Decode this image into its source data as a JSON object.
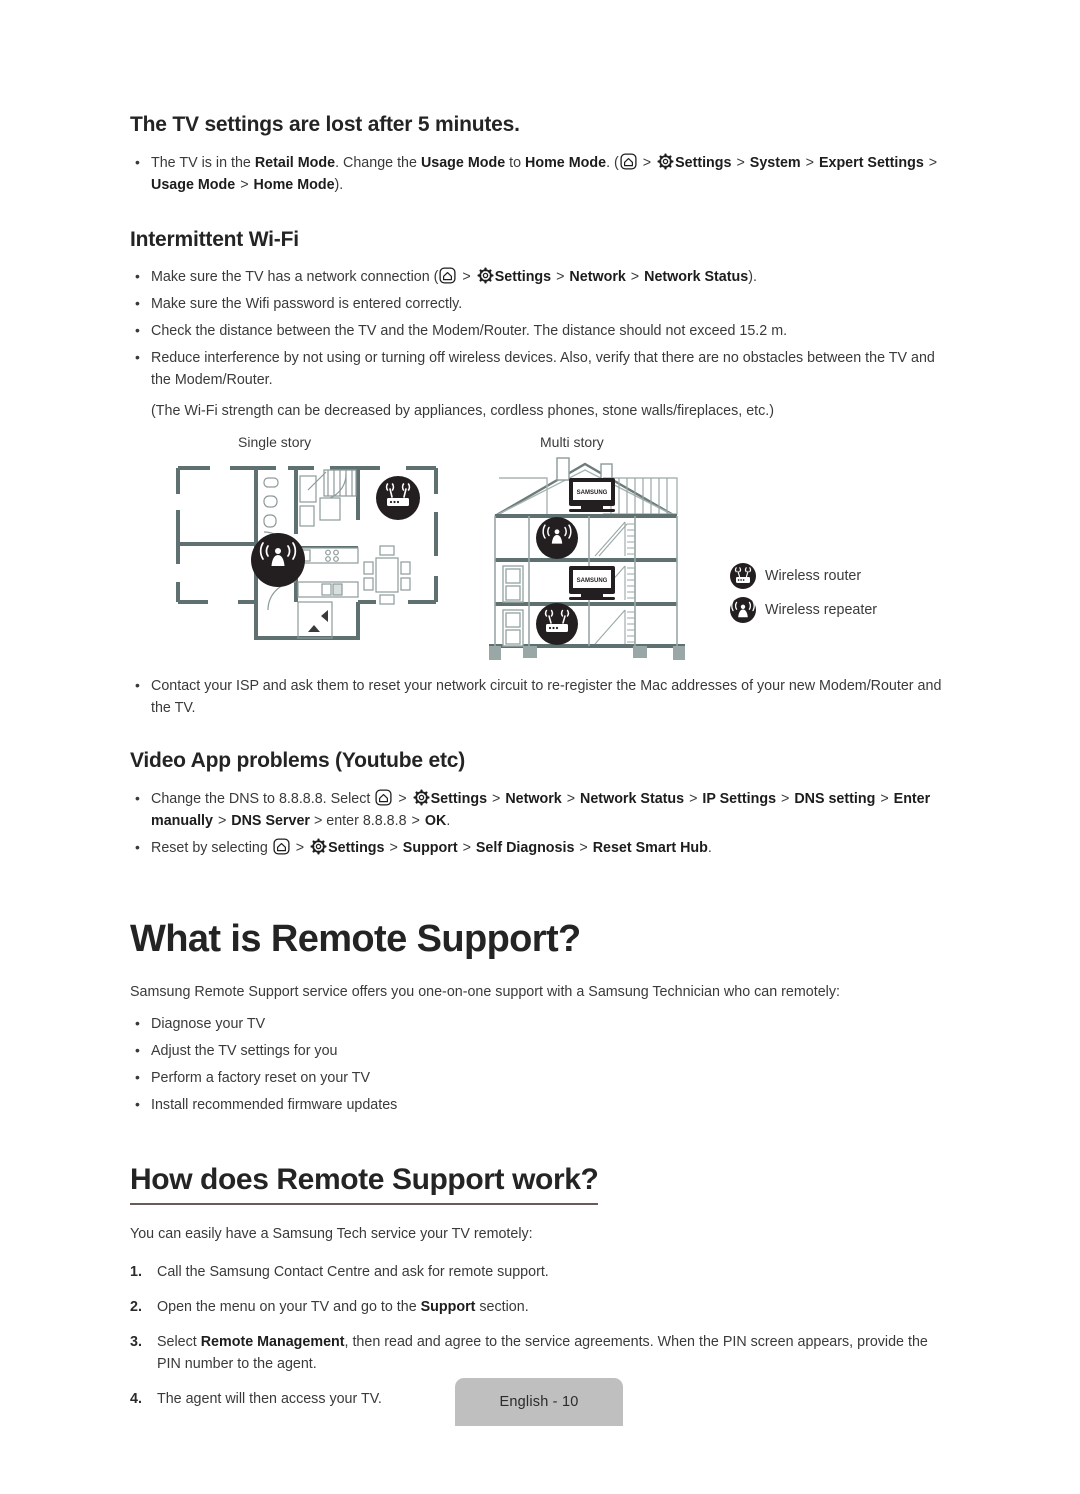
{
  "document": {
    "footer_label": "English - 10",
    "icons": {
      "home": "home-icon",
      "gear": "gear-icon"
    }
  },
  "colors": {
    "text": "#3a3a3a",
    "heading": "#242424",
    "wall": "#5f7070",
    "badge": "#231f20",
    "footer_bg": "#bfbfbf",
    "rule": "#6b5a5a"
  },
  "sections": {
    "tv_settings_lost": {
      "heading": "The TV settings are lost after 5 minutes.",
      "bullets": [
        {
          "parts": [
            {
              "t": "The TV is in the "
            },
            {
              "t": "Retail Mode",
              "b": true
            },
            {
              "t": ". Change the "
            },
            {
              "t": "Usage Mode",
              "b": true
            },
            {
              "t": " to "
            },
            {
              "t": "Home Mode",
              "b": true
            },
            {
              "t": ". ("
            },
            {
              "icon": "home-icon"
            },
            {
              "t": " > ",
              "sep": true
            },
            {
              "icon": "gear-icon"
            },
            {
              "t": "Settings",
              "b": true
            },
            {
              "t": " > ",
              "sep": true
            },
            {
              "t": "System",
              "b": true
            },
            {
              "t": " > ",
              "sep": true
            },
            {
              "t": "Expert Settings",
              "b": true
            },
            {
              "t": " > ",
              "sep": true
            },
            {
              "t": "Usage Mode",
              "b": true
            },
            {
              "t": " > ",
              "sep": true
            },
            {
              "t": "Home Mode",
              "b": true
            },
            {
              "t": ")."
            }
          ]
        }
      ]
    },
    "intermittent_wifi": {
      "heading": "Intermittent Wi-Fi",
      "bullets": [
        {
          "parts": [
            {
              "t": "Make sure the TV has a network connection ("
            },
            {
              "icon": "home-icon"
            },
            {
              "t": " > ",
              "sep": true
            },
            {
              "icon": "gear-icon"
            },
            {
              "t": "Settings",
              "b": true
            },
            {
              "t": " > ",
              "sep": true
            },
            {
              "t": "Network",
              "b": true
            },
            {
              "t": " > ",
              "sep": true
            },
            {
              "t": "Network Status",
              "b": true
            },
            {
              "t": ")."
            }
          ]
        },
        {
          "parts": [
            {
              "t": "Make sure the Wifi password is entered correctly."
            }
          ]
        },
        {
          "parts": [
            {
              "t": "Check the distance between the TV and the Modem/Router. The distance should not exceed 15.2 m."
            }
          ]
        },
        {
          "parts": [
            {
              "t": "Reduce interference by not using or turning off wireless devices. Also, verify that there are no obstacles between the TV and the Modem/Router."
            }
          ]
        }
      ],
      "note": "(The Wi-Fi strength can be decreased by appliances, cordless phones, stone walls/fireplaces, etc.)",
      "diagram": {
        "caption_single": "Single story",
        "caption_multi": "Multi story",
        "tv_brand": "SAMSUNG",
        "legend": [
          {
            "icon": "wireless-router-icon",
            "label": "Wireless router"
          },
          {
            "icon": "wireless-repeater-icon",
            "label": "Wireless repeater"
          }
        ]
      },
      "trailing_bullets": [
        {
          "parts": [
            {
              "t": "Contact your ISP and ask them to reset your network circuit to re-register the Mac addresses of your new Modem/Router and the TV."
            }
          ]
        }
      ]
    },
    "video_app_problems": {
      "heading": "Video App problems (Youtube etc)",
      "bullets": [
        {
          "parts": [
            {
              "t": "Change the DNS to 8.8.8.8. Select "
            },
            {
              "icon": "home-icon"
            },
            {
              "t": " > ",
              "sep": true
            },
            {
              "icon": "gear-icon"
            },
            {
              "t": "Settings",
              "b": true
            },
            {
              "t": " > ",
              "sep": true
            },
            {
              "t": "Network",
              "b": true
            },
            {
              "t": " > ",
              "sep": true
            },
            {
              "t": "Network Status",
              "b": true
            },
            {
              "t": " > ",
              "sep": true
            },
            {
              "t": "IP Settings",
              "b": true
            },
            {
              "t": " > ",
              "sep": true
            },
            {
              "t": "DNS setting",
              "b": true
            },
            {
              "t": " > ",
              "sep": true
            },
            {
              "t": "Enter manually",
              "b": true
            },
            {
              "t": " > ",
              "sep": true
            },
            {
              "t": "DNS Server",
              "b": true
            },
            {
              "t": " > enter "
            },
            {
              "t": "8.8.8.8",
              "b": false
            },
            {
              "t": " > ",
              "sep": true
            },
            {
              "t": "OK",
              "b": true
            },
            {
              "t": "."
            }
          ]
        },
        {
          "parts": [
            {
              "t": "Reset by selecting "
            },
            {
              "icon": "home-icon"
            },
            {
              "t": " > ",
              "sep": true
            },
            {
              "icon": "gear-icon"
            },
            {
              "t": "Settings",
              "b": true
            },
            {
              "t": " > ",
              "sep": true
            },
            {
              "t": "Support",
              "b": true
            },
            {
              "t": " > ",
              "sep": true
            },
            {
              "t": "Self Diagnosis",
              "b": true
            },
            {
              "t": " > ",
              "sep": true
            },
            {
              "t": "Reset Smart Hub",
              "b": true
            },
            {
              "t": "."
            }
          ]
        }
      ]
    },
    "what_is_remote_support": {
      "heading": "What is Remote Support?",
      "intro": "Samsung Remote Support service offers you one-on-one support with a Samsung Technician who can remotely:",
      "bullets": [
        {
          "parts": [
            {
              "t": "Diagnose your TV"
            }
          ]
        },
        {
          "parts": [
            {
              "t": "Adjust the TV settings for you"
            }
          ]
        },
        {
          "parts": [
            {
              "t": "Perform a factory reset on your TV"
            }
          ]
        },
        {
          "parts": [
            {
              "t": "Install recommended firmware updates"
            }
          ]
        }
      ]
    },
    "how_does_remote_support_work": {
      "heading": "How does Remote Support work?",
      "intro": "You can easily have a Samsung Tech service your TV remotely:",
      "steps": [
        {
          "n": "1.",
          "parts": [
            {
              "t": "Call the Samsung Contact Centre and ask for remote support."
            }
          ]
        },
        {
          "n": "2.",
          "parts": [
            {
              "t": "Open the menu on your TV and go to the "
            },
            {
              "t": "Support",
              "b": true
            },
            {
              "t": " section."
            }
          ]
        },
        {
          "n": "3.",
          "parts": [
            {
              "t": "Select "
            },
            {
              "t": "Remote Management",
              "b": true
            },
            {
              "t": ", then read and agree to the service agreements. When the PIN screen appears, provide the PIN number to the agent."
            }
          ]
        },
        {
          "n": "4.",
          "parts": [
            {
              "t": "The agent will then access your TV."
            }
          ]
        }
      ]
    }
  }
}
